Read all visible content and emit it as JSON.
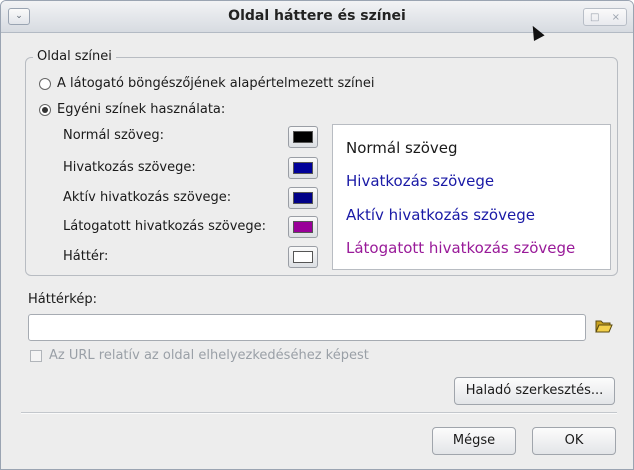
{
  "window": {
    "title": "Oldal háttere és színei",
    "menu_glyph": "⌄",
    "maximize_glyph": "□",
    "close_glyph": "×"
  },
  "group": {
    "legend": "Oldal színei",
    "radio_default": {
      "label": "A látogató böngészőjének alapértelmezett színei",
      "checked": false
    },
    "radio_custom": {
      "label": "Egyéni színek használata:",
      "checked": true
    }
  },
  "colors": [
    {
      "label": "Normál szöveg:",
      "color": "#000000"
    },
    {
      "label": "Hivatkozás szövege:",
      "color": "#000099"
    },
    {
      "label": "Aktív hivatkozás szövege:",
      "color": "#000088"
    },
    {
      "label": "Látogatott hivatkozás szövege:",
      "color": "#990099"
    },
    {
      "label": "Háttér:",
      "color": "#ffffff"
    }
  ],
  "preview": {
    "normal": "Normál szöveg",
    "link": "Hivatkozás szövege",
    "active": "Aktív hivatkozás szövege",
    "visited": "Látogatott hivatkozás szövege",
    "normal_color": "#1a1a1a",
    "link_color": "#1a1aa6",
    "active_color": "#1a1aa6",
    "visited_color": "#991a99"
  },
  "background": {
    "label": "Háttérkép:",
    "value": "",
    "relative_label": "Az URL relatív az oldal elhelyezkedéséhez képest",
    "relative_checked": false
  },
  "buttons": {
    "advanced": "Haladó szerkesztés...",
    "cancel": "Mégse",
    "ok": "OK"
  }
}
